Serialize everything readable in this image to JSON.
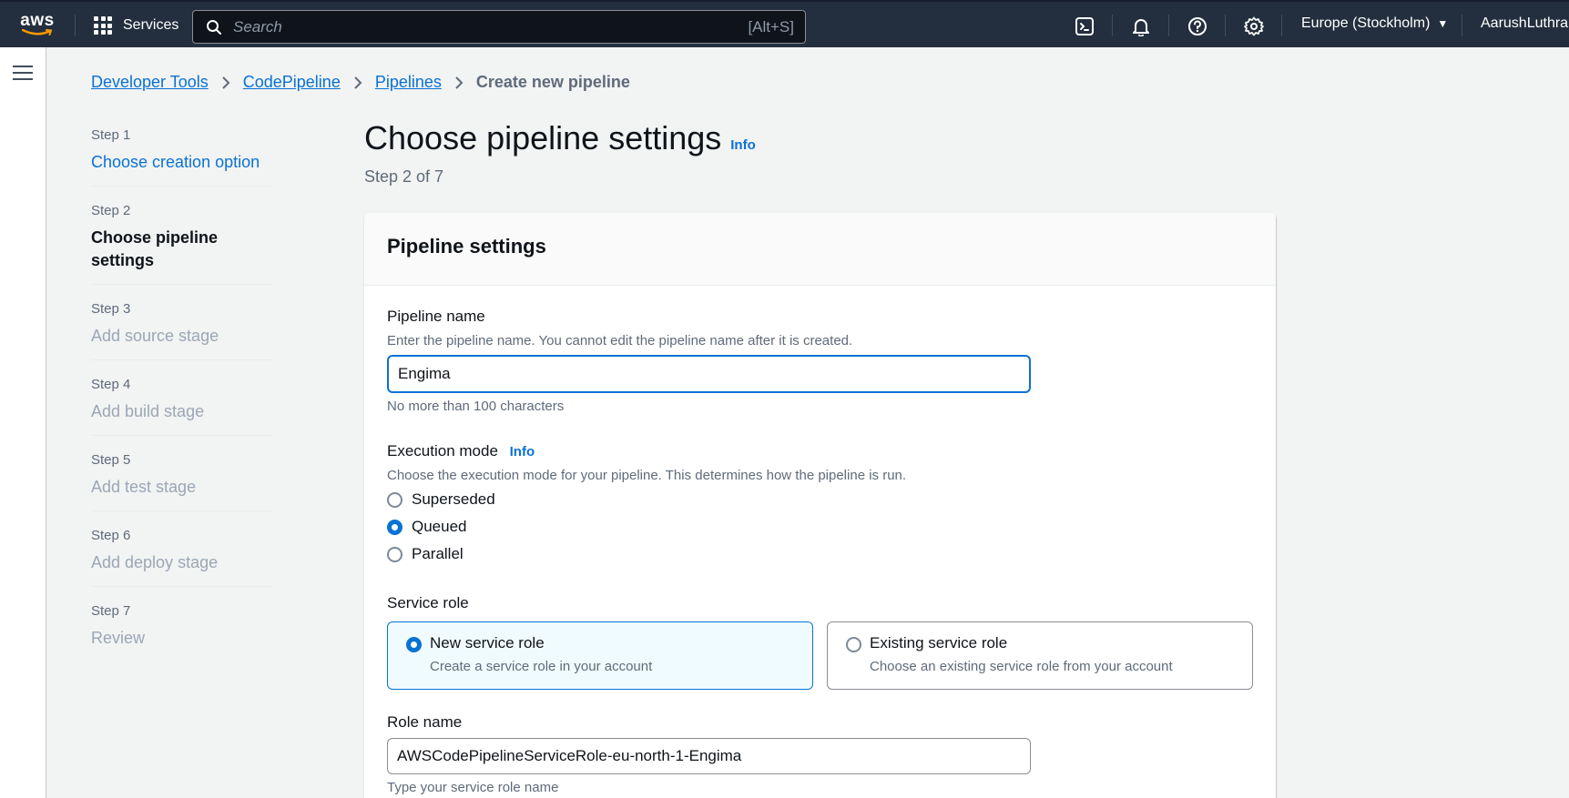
{
  "topnav": {
    "logo_text": "aws",
    "services_label": "Services",
    "search_placeholder": "Search",
    "search_shortcut": "[Alt+S]",
    "region": "Europe (Stockholm)",
    "user": "AarushLuthra"
  },
  "breadcrumbs": {
    "items": [
      "Developer Tools",
      "CodePipeline",
      "Pipelines"
    ],
    "current": "Create new pipeline"
  },
  "steps": [
    {
      "num": "Step 1",
      "title": "Choose creation option",
      "state": "link"
    },
    {
      "num": "Step 2",
      "title": "Choose pipeline settings",
      "state": "active"
    },
    {
      "num": "Step 3",
      "title": "Add source stage",
      "state": "disabled"
    },
    {
      "num": "Step 4",
      "title": "Add build stage",
      "state": "disabled"
    },
    {
      "num": "Step 5",
      "title": "Add test stage",
      "state": "disabled"
    },
    {
      "num": "Step 6",
      "title": "Add deploy stage",
      "state": "disabled"
    },
    {
      "num": "Step 7",
      "title": "Review",
      "state": "disabled"
    }
  ],
  "header": {
    "title": "Choose pipeline settings",
    "info": "Info",
    "step_of": "Step 2 of 7"
  },
  "panel": {
    "title": "Pipeline settings",
    "pipeline_name": {
      "label": "Pipeline name",
      "description": "Enter the pipeline name. You cannot edit the pipeline name after it is created.",
      "value": "Engima",
      "hint": "No more than 100 characters"
    },
    "execution_mode": {
      "label": "Execution mode",
      "info": "Info",
      "description": "Choose the execution mode for your pipeline. This determines how the pipeline is run.",
      "options": [
        "Superseded",
        "Queued",
        "Parallel"
      ],
      "selected": "Queued"
    },
    "service_role": {
      "label": "Service role",
      "new_title": "New service role",
      "new_desc": "Create a service role in your account",
      "existing_title": "Existing service role",
      "existing_desc": "Choose an existing service role from your account",
      "selected": "New service role"
    },
    "role_name": {
      "label": "Role name",
      "value": "AWSCodePipelineServiceRole-eu-north-1-Engima",
      "hint": "Type your service role name"
    }
  },
  "colors": {
    "nav_bg": "#232f3e",
    "link": "#0972d3",
    "page_bg": "#f2f3f3"
  }
}
